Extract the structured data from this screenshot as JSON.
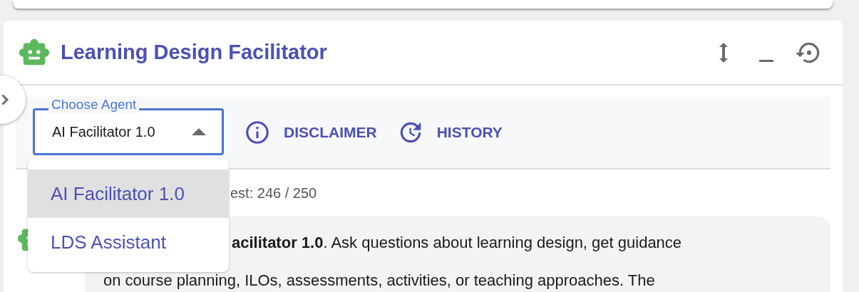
{
  "header": {
    "title": "Learning Design Facilitator"
  },
  "agent_select": {
    "label": "Choose Agent",
    "value": "AI Facilitator 1.0",
    "expanded": true
  },
  "actions": [
    {
      "label": "DISCLAIMER",
      "kind": "info"
    },
    {
      "label": "HISTORY",
      "kind": "history"
    }
  ],
  "menu": [
    {
      "label": "AI Facilitator 1.0",
      "selected": true
    },
    {
      "label": "LDS Assistant",
      "selected": false
    }
  ],
  "quota": {
    "text": "est: 246 / 250"
  },
  "message": {
    "lines": [
      "**acilitator 1.0**. Ask questions about learning design, get guidance",
      "on course planning, ILOs, assessments, activities, or teaching approaches. The"
    ]
  }
}
